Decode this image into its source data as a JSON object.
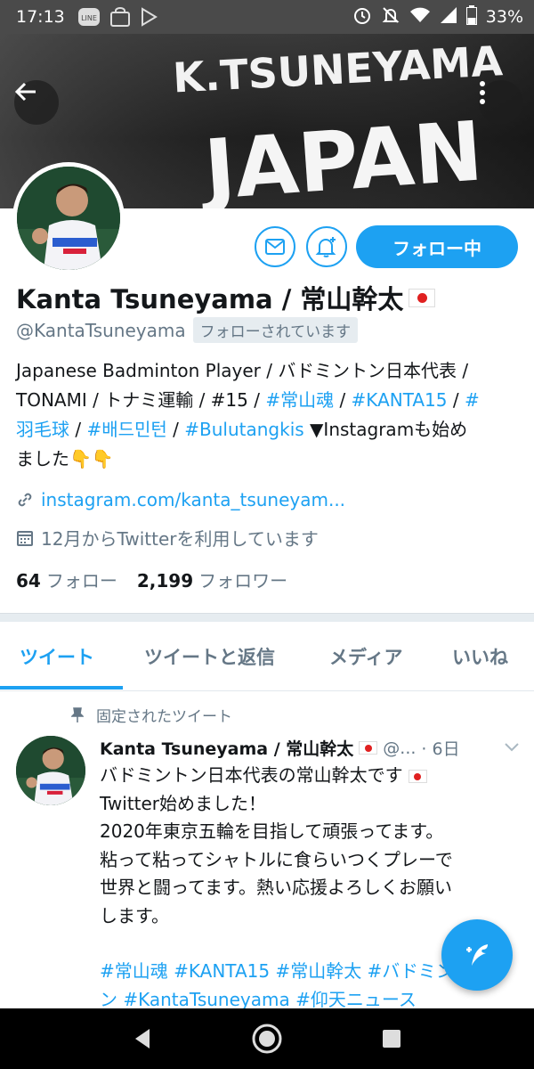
{
  "status_bar": {
    "time": "17:13",
    "left_icons": [
      "line-icon",
      "shopping-bag-icon",
      "play-store-icon"
    ],
    "right_icons": [
      "alarm-icon",
      "mute-icon",
      "wifi-icon",
      "signal-icon",
      "battery-icon"
    ],
    "battery": "33%"
  },
  "banner": {
    "line1": "K.TSUNEYAMA",
    "line2": "JAPAN"
  },
  "profile": {
    "name": "Kanta Tsuneyama / 常山幹太",
    "handle": "@KantaTsuneyama",
    "follows_you": "フォローされています",
    "follow_button": "フォロー中",
    "bio": {
      "line1": "Japanese Badminton Player / バドミントン日本代表 /",
      "line2_a": "TONAMI / トナミ運輸 / #15 / ",
      "tag1": "#常山魂",
      "sep1": " / ",
      "tag2": "#KANTA15",
      "sep2": " / ",
      "tag3a": "#",
      "tag3b": "羽毛球",
      "sep3": " / ",
      "tag4": "#배드민턴",
      "sep4": " / ",
      "tag5": "#Bulutangkis",
      "line3_b": " ▼Instagramも始め",
      "line4": "ました👇👇"
    },
    "url": "instagram.com/kanta_tsuneyam...",
    "joined": "12月からTwitterを利用しています",
    "following_count": "64",
    "following_label": "フォロー",
    "followers_count": "2,199",
    "followers_label": "フォロワー"
  },
  "tabs": [
    {
      "label": "ツイート",
      "active": true
    },
    {
      "label": "ツイートと返信",
      "active": false
    },
    {
      "label": "メディア",
      "active": false
    },
    {
      "label": "いいね",
      "active": false
    }
  ],
  "pinned_tweet": {
    "pinned_label": "固定されたツイート",
    "author_name": "Kanta Tsuneyama / 常山幹太",
    "author_handle": "@...",
    "date": "· 6日",
    "line1": "バドミントン日本代表の常山幹太です",
    "line2": "Twitter始めました！",
    "line3": "2020年東京五輪を目指して頑張ってます。",
    "line4": "粘って粘ってシャトルに食らいつくプレーで",
    "line5": "世界と闘ってます。熱い応援よろしくお願い",
    "line6": "します。",
    "hashtags_line1": "#常山魂 #KANTA15 #常山幹太 #バドミント",
    "hashtags_line2": "ン #KantaTsuneyama #仰天ニュース"
  },
  "colors": {
    "accent": "#1da1f2",
    "text": "#14171a",
    "secondary": "#657786"
  }
}
